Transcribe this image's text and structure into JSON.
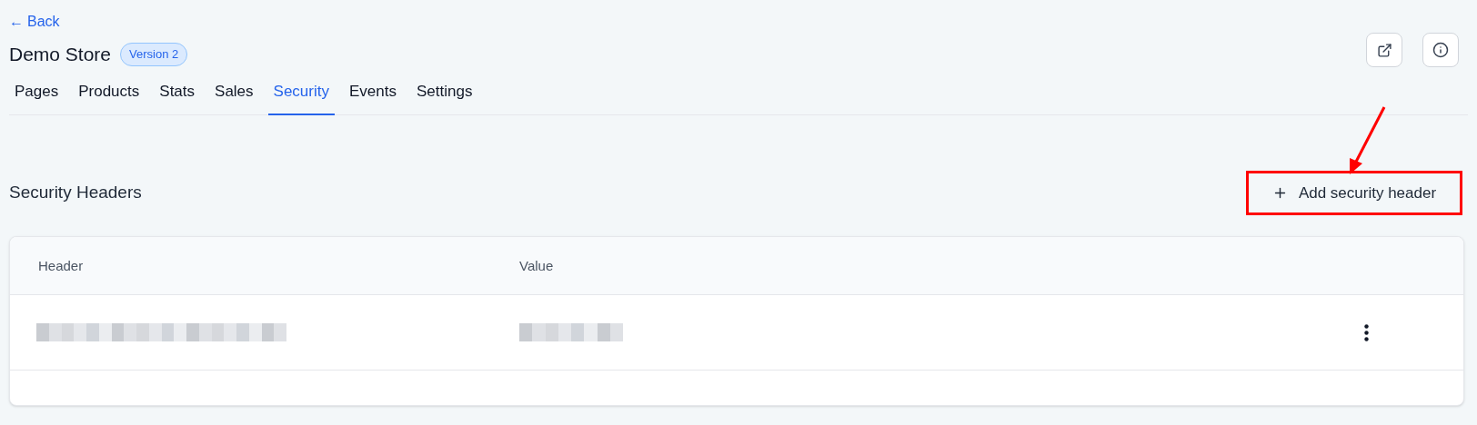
{
  "back_link": {
    "label": "Back",
    "arrow": "←"
  },
  "title": "Demo Store",
  "version_badge": "Version 2",
  "tabs": [
    {
      "label": "Pages",
      "selected": false
    },
    {
      "label": "Products",
      "selected": false
    },
    {
      "label": "Stats",
      "selected": false
    },
    {
      "label": "Sales",
      "selected": false
    },
    {
      "label": "Security",
      "selected": true
    },
    {
      "label": "Events",
      "selected": false
    },
    {
      "label": "Settings",
      "selected": false
    }
  ],
  "section": {
    "title": "Security Headers",
    "add_button": {
      "label": "Add security header",
      "highlighted": true
    }
  },
  "table": {
    "columns": [
      "Header",
      "Value"
    ],
    "rows": [
      {
        "cells": [
          {
            "kind": "redacted"
          },
          {
            "kind": "redacted"
          }
        ],
        "has_menu": true
      }
    ]
  }
}
